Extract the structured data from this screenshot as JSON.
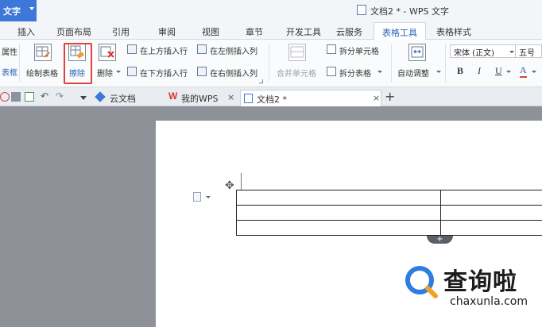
{
  "app": {
    "label": "文字",
    "window_title": "文档2 * - WPS 文字"
  },
  "menu": {
    "tabs": [
      "插入",
      "页面布局",
      "引用",
      "审阅",
      "视图",
      "章节",
      "开发工具",
      "云服务",
      "表格工具",
      "表格样式"
    ],
    "active_tab": "表格工具"
  },
  "ribbon": {
    "partial_top": "属性",
    "partial_bottom": "表框",
    "draw_table": "绘制表格",
    "erase": "擦除",
    "delete": "删除",
    "insert_above": "在上方插入行",
    "insert_below": "在下方插入行",
    "insert_left": "在左侧插入列",
    "insert_right": "在右侧插入列",
    "merge_cells": "合并单元格",
    "split_cells": "拆分单元格",
    "split_table": "拆分表格",
    "auto_adjust": "自动调整",
    "font_name": "宋体 (正文)",
    "font_size": "五号",
    "bold": "B",
    "italic": "I",
    "underline": "U",
    "font_color": "A"
  },
  "doc_tabs": {
    "tabs": [
      {
        "label": "云文档",
        "closable": false
      },
      {
        "label": "我的WPS",
        "closable": true
      },
      {
        "label": "文档2 *",
        "closable": true
      }
    ],
    "close_glyph": "×",
    "new_tab_glyph": "+",
    "active_index": 2
  },
  "document": {
    "table": {
      "rows": 3,
      "cols": 2
    },
    "add_row_glyph": "+",
    "move_handle_glyph": "✥"
  },
  "watermark": {
    "text": "查询啦",
    "domain": "chaxunla.com"
  },
  "colors": {
    "accent": "#2a62b8",
    "app_button": "#3d78d8",
    "highlight": "#e0413c",
    "workspace": "#8e9298"
  }
}
